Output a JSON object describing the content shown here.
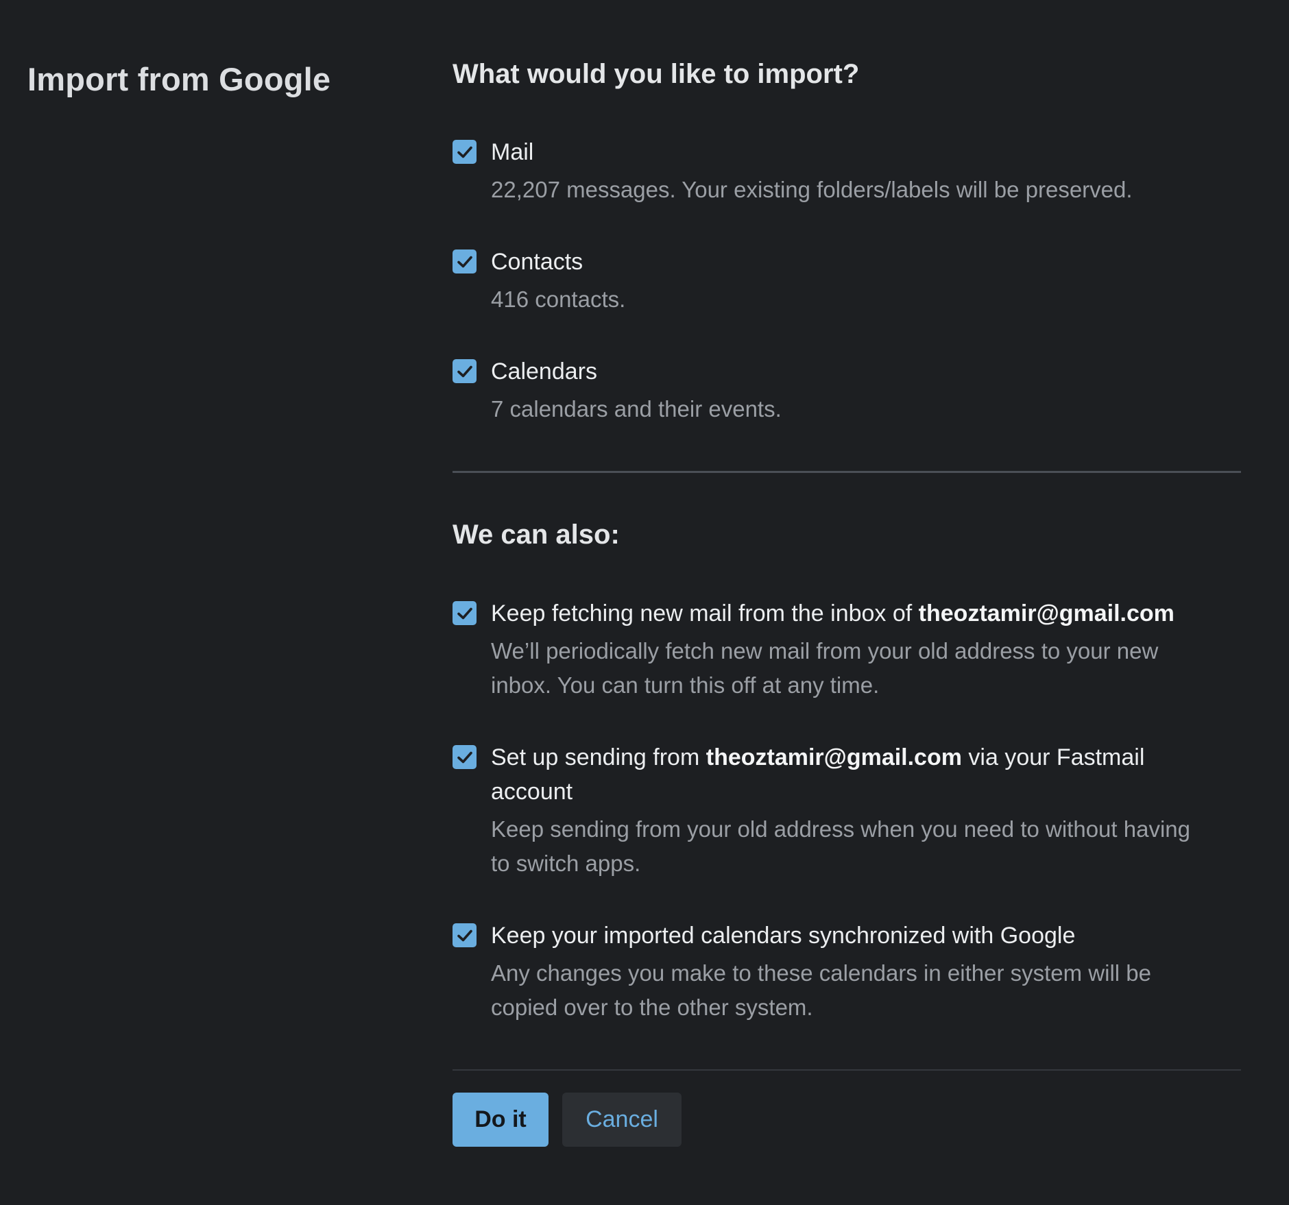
{
  "page": {
    "title": "Import from Google"
  },
  "import_section": {
    "heading": "What would you like to import?",
    "options": [
      {
        "label": "Mail",
        "description": "22,207 messages. Your existing folders/labels will be preserved.",
        "checked": true
      },
      {
        "label": "Contacts",
        "description": "416 contacts.",
        "checked": true
      },
      {
        "label": "Calendars",
        "description": "7 calendars and their events.",
        "checked": true
      }
    ]
  },
  "also_section": {
    "heading": "We can also:",
    "options": [
      {
        "label_before": "Keep fetching new mail from the inbox of ",
        "email": "theoztamir@gmail.com",
        "label_after": "",
        "description": "We’ll periodically fetch new mail from your old address to your new inbox. You can turn this off at any time.",
        "checked": true
      },
      {
        "label_before": "Set up sending from ",
        "email": "theoztamir@gmail.com",
        "label_after": " via your Fastmail account",
        "description": "Keep sending from your old address when you need to without having to switch apps.",
        "checked": true
      },
      {
        "label_before": "Keep your imported calendars synchronized with Google",
        "email": "",
        "label_after": "",
        "description": "Any changes you make to these calendars in either system will be copied over to the other system.",
        "checked": true
      }
    ]
  },
  "actions": {
    "primary_label": "Do it",
    "secondary_label": "Cancel"
  },
  "icons": {
    "checkbox": "checkmark-icon"
  },
  "colors": {
    "background": "#1d1f22",
    "accent": "#6aaee0",
    "text": "#eceef0",
    "muted_text": "#9b9fa5",
    "secondary_button_bg": "#2c2f33"
  }
}
